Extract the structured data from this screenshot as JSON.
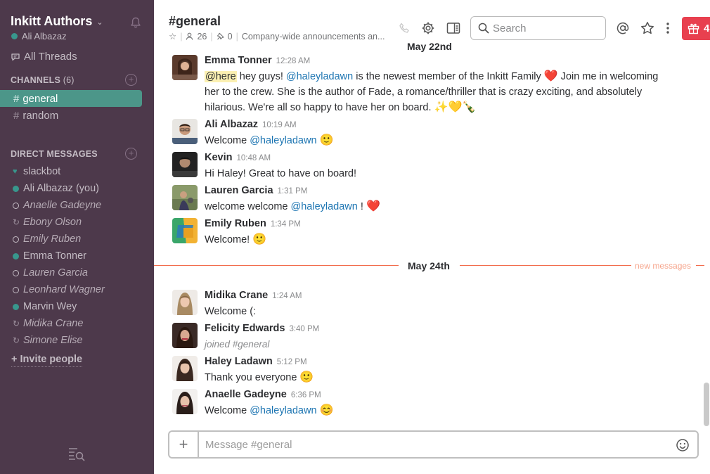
{
  "sidebar": {
    "team_name": "Inkitt Authors",
    "user": "Ali Albazaz",
    "all_threads": "All Threads",
    "channels_header": "CHANNELS",
    "channels_count": "(6)",
    "channels": [
      {
        "name": "general",
        "active": true
      },
      {
        "name": "random",
        "active": false
      }
    ],
    "dm_header": "DIRECT MESSAGES",
    "dms": [
      {
        "name": "slackbot",
        "status": "bot"
      },
      {
        "name": "Ali Albazaz (you)",
        "status": "online"
      },
      {
        "name": "Anaelle Gadeyne",
        "status": "away"
      },
      {
        "name": "Ebony Olson",
        "status": "external"
      },
      {
        "name": "Emily Ruben",
        "status": "away"
      },
      {
        "name": "Emma Tonner",
        "status": "online"
      },
      {
        "name": "Lauren Garcia",
        "status": "away"
      },
      {
        "name": "Leonhard Wagner",
        "status": "away"
      },
      {
        "name": "Marvin Wey",
        "status": "online"
      },
      {
        "name": "Midika Crane",
        "status": "external"
      },
      {
        "name": "Simone Elise",
        "status": "external"
      }
    ],
    "invite": "+ Invite people"
  },
  "header": {
    "channel": "#general",
    "members": "26",
    "pins": "0",
    "topic": "Company-wide announcements an...",
    "search_placeholder": "Search",
    "gift_count": "4"
  },
  "days": {
    "first": "May 22nd",
    "second": "May 24th",
    "new_messages": "new messages"
  },
  "messages": [
    {
      "author": "Emma Tonner",
      "time": "12:28 AM",
      "here": "@here",
      "t1": " hey guys! ",
      "mention": "@haleyladawn",
      "t2": " is the newest member of the Inkitt Family ",
      "t3": " Join me in welcoming her to the crew. She is the author of Fade, a romance/thriller that is crazy exciting, and absolutely hilarious. We're all so happy to have her on board. ",
      "emoji1": "❤️",
      "emoji2": "✨💛🍾"
    },
    {
      "author": "Ali Albazaz",
      "time": "10:19 AM",
      "t1": "Welcome ",
      "mention": "@haleyladawn",
      "emoji": "🙂"
    },
    {
      "author": "Kevin",
      "time": "10:48 AM",
      "t1": "Hi Haley! Great to have on board!"
    },
    {
      "author": "Lauren Garcia",
      "time": "1:31 PM",
      "t1": "welcome welcome ",
      "mention": "@haleyladawn",
      "t2": " ! ",
      "emoji": "❤️"
    },
    {
      "author": "Emily Ruben",
      "time": "1:34 PM",
      "t1": "Welcome! ",
      "emoji": "🙂"
    },
    {
      "author": "Midika Crane",
      "time": "1:24 AM",
      "t1": "Welcome (:"
    },
    {
      "author": "Felicity Edwards",
      "time": "3:40 PM",
      "t1": "joined #general"
    },
    {
      "author": "Haley Ladawn",
      "time": "5:12 PM",
      "t1": "Thank you everyone ",
      "emoji": "🙂"
    },
    {
      "author": "Anaelle Gadeyne",
      "time": "6:36 PM",
      "t1": "Welcome ",
      "mention": "@haleyladawn",
      "emoji": "😊"
    }
  ],
  "composer": {
    "placeholder": "Message #general"
  },
  "icons": {
    "bell": "bell-icon",
    "threads": "threads-icon",
    "call": "phone-icon",
    "settings": "gear-icon",
    "details": "sidebar-toggle-icon",
    "search": "search-icon",
    "mentions": "at-icon",
    "starred": "star-icon",
    "more": "more-icon",
    "gift": "gift-icon",
    "emoji": "emoji-icon"
  },
  "colors": {
    "sidebar_bg": "#4d394b",
    "active_channel": "#4c9689",
    "online": "#38978d",
    "mention": "#1d75b2",
    "new_messages": "#f26d4d",
    "gift": "#e8404f"
  }
}
